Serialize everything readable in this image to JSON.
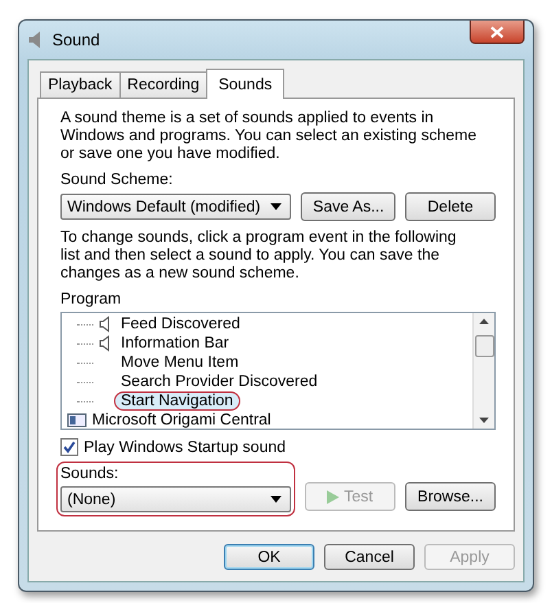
{
  "window": {
    "title": "Sound"
  },
  "tabs": [
    {
      "label": "Playback",
      "selected": false
    },
    {
      "label": "Recording",
      "selected": false
    },
    {
      "label": "Sounds",
      "selected": true
    }
  ],
  "intro": "A sound theme is a set of sounds applied to events in Windows and programs.  You can select an existing scheme or save one you have modified.",
  "scheme": {
    "label": "Sound Scheme:",
    "value": "Windows Default (modified)",
    "buttons": [
      {
        "label": "Save As...",
        "disabled": false
      },
      {
        "label": "Delete",
        "disabled": false
      }
    ]
  },
  "instructions": "To change sounds, click a program event in the following list and then select a sound to apply.  You can save the changes as a new sound scheme.",
  "program_list": {
    "label": "Program",
    "items": [
      {
        "children": [
          {
            "label": "Feed Discovered",
            "has_sound": true,
            "selected": false,
            "annotated": false
          },
          {
            "label": "Information Bar",
            "has_sound": true,
            "selected": false,
            "annotated": false
          },
          {
            "label": "Move Menu Item",
            "has_sound": false,
            "selected": false,
            "annotated": false
          },
          {
            "label": "Search Provider Discovered",
            "has_sound": false,
            "selected": false,
            "annotated": false
          },
          {
            "label": "Start Navigation",
            "has_sound": false,
            "selected": true,
            "annotated": true
          }
        ]
      },
      {
        "label": "Microsoft Origami Central",
        "selected": false,
        "annotated": false
      }
    ]
  },
  "startup": {
    "label": "Play Windows Startup sound",
    "checked": true
  },
  "sounds": {
    "label": "Sounds:",
    "value": "(None)",
    "annotated": true
  },
  "sound_buttons": [
    {
      "label": "Test",
      "disabled": true
    },
    {
      "label": "Browse...",
      "disabled": false
    }
  ],
  "dialog_buttons": [
    {
      "label": "OK",
      "disabled": false,
      "default": true
    },
    {
      "label": "Cancel",
      "disabled": false,
      "default": false
    },
    {
      "label": "Apply",
      "disabled": true,
      "default": false
    }
  ]
}
